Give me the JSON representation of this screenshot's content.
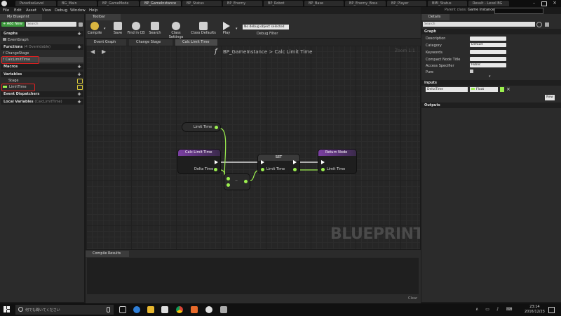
{
  "window": {
    "tabs": [
      "ParadiseLevel",
      "BG_Main",
      "BP_GameMode",
      "BP_GameInstance",
      "BP_Status",
      "BP_Enemy",
      "BP_Robot",
      "BP_Base",
      "BP_Enemy_Boss",
      "BP_Player",
      "BMI_Status",
      "Result - Level BG"
    ],
    "menu": [
      "File",
      "Edit",
      "Asset",
      "View",
      "Debug",
      "Window",
      "Help"
    ],
    "right_controls": [
      "Parent class:",
      "Game Instance"
    ]
  },
  "left_panel": {
    "tab": "My Blueprint",
    "add_new": "+ Add New",
    "search_placeholder": "Search",
    "graphs_label": "Graphs",
    "event_graph": "EventGraph",
    "functions_label": "Functions",
    "functions_overridable": "(4 Overridable)",
    "functions": [
      "ChangeStage",
      "CalcLimitTime"
    ],
    "macros_label": "Macros",
    "variables_label": "Variables",
    "variables": [
      "Stage",
      "LimitTime"
    ],
    "event_dispatchers_label": "Event Dispatchers",
    "local_variables_label": "Local Variables",
    "local_variables_scope": "(CalcLimitTime)"
  },
  "toolbar": {
    "tab": "Toolbar",
    "buttons": [
      "Compile",
      "Save",
      "Find in CB",
      "Search",
      "Class Settings",
      "Class Defaults",
      "Play"
    ],
    "debug_select": "No debug object selected",
    "debug_filter": "Debug Filter"
  },
  "graph": {
    "tabs": [
      "Event Graph",
      "Change Stage",
      "Calc Limit Time"
    ],
    "breadcrumb_blueprint": "BP_GameInstance",
    "breadcrumb_sep": ">",
    "breadcrumb_function": "Calc Limit Time",
    "zoom": "Zoom 1:1",
    "watermark": "BLUEPRINT",
    "nodes": {
      "getter": "Limit Time",
      "entry_title": "Calc Limit Time",
      "entry_pin": "Delta Time",
      "subtract_op": "−",
      "set_title": "SET",
      "set_pin": "Limit Time",
      "return_title": "Return Node",
      "return_pin": "Limit Time"
    }
  },
  "compile_results": {
    "tab": "Compile Results",
    "clear": "Clear"
  },
  "details": {
    "tab": "Details",
    "search_placeholder": "Search",
    "graph_section": "Graph",
    "rows": [
      "Description",
      "Category",
      "Keywords",
      "Compact Node Title",
      "Access Specifier",
      "Pure"
    ],
    "category_value": "Default",
    "access_value": "Public",
    "inputs_section": "Inputs",
    "input_name": "DeltaTime",
    "input_type": "Float",
    "new_button": "New",
    "outputs_section": "Outputs"
  },
  "taskbar": {
    "search_text": "何でも聞いてください",
    "time": "23:14",
    "date": "2016/12/23"
  },
  "colors": {
    "function_header": "#7b3fa3",
    "float_pin": "#9cf04f",
    "add_new_green": "#3d9a3d"
  }
}
